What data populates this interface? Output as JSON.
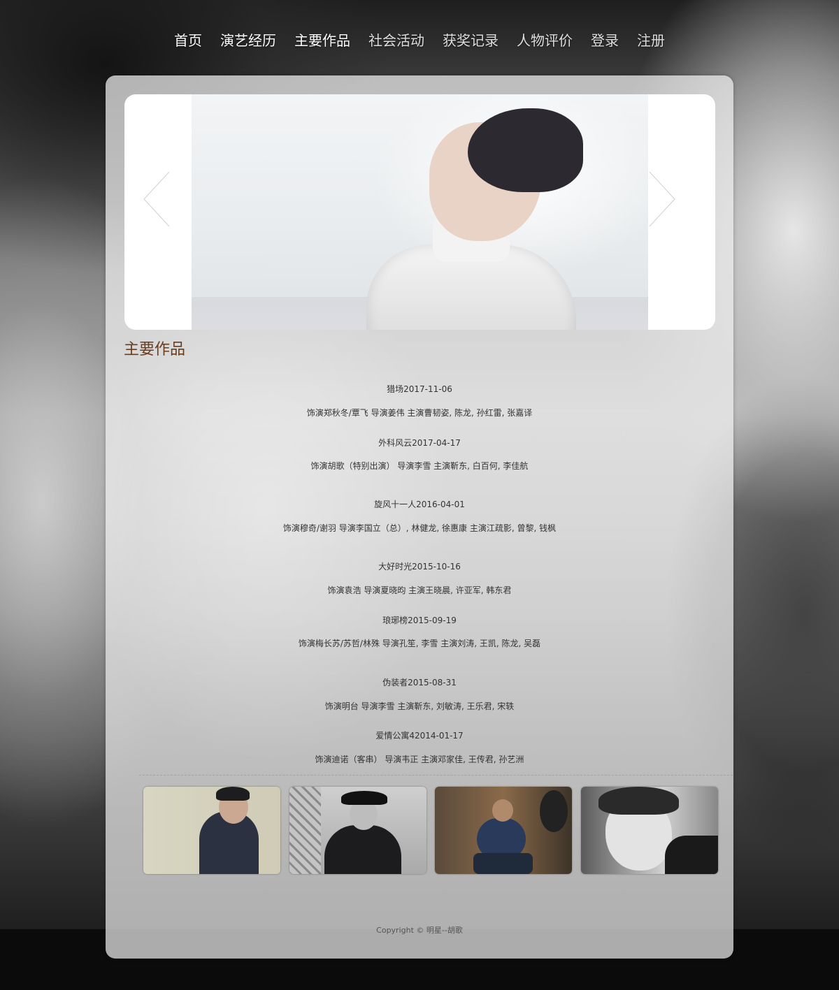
{
  "nav": {
    "items": [
      {
        "label": "首页"
      },
      {
        "label": "演艺经历"
      },
      {
        "label": "主要作品"
      },
      {
        "label": "社会活动"
      },
      {
        "label": "获奖记录"
      },
      {
        "label": "人物评价"
      },
      {
        "label": "登录"
      },
      {
        "label": "注册"
      }
    ]
  },
  "carousel": {
    "prev_icon": "chevron-left-icon",
    "next_icon": "chevron-right-icon"
  },
  "section": {
    "title": "主要作品"
  },
  "works": [
    {
      "title": "猎场2017-11-06",
      "desc": "饰演郑秋冬/覃飞 导演姜伟 主演曹韧姿, 陈龙, 孙红雷, 张嘉译"
    },
    {
      "title": "外科风云2017-04-17",
      "desc": "饰演胡歌（特别出演） 导演李雪 主演靳东, 白百何, 李佳航"
    },
    {
      "title": "旋风十一人2016-04-01",
      "desc": "饰演穆奇/谢羽 导演李国立（总）, 林健龙, 徐惠康 主演江疏影, 曾黎, 钱枫"
    },
    {
      "title": "大好时光2015-10-16",
      "desc": "饰演袁浩 导演夏晓昀 主演王晓晨, 许亚军, 韩东君"
    },
    {
      "title": "琅琊榜2015-09-19",
      "desc": "饰演梅长苏/苏哲/林殊 导演孔笙, 李雪 主演刘涛, 王凯, 陈龙, 吴磊"
    },
    {
      "title": "伪装者2015-08-31",
      "desc": "饰演明台 导演李雪 主演靳东, 刘敏涛, 王乐君, 宋轶"
    },
    {
      "title": "爱情公寓42014-01-17",
      "desc": "饰演迪诺（客串） 导演韦正 主演邓家佳, 王传君, 孙艺洲"
    }
  ],
  "thumbnails": [
    {
      "name": "photo-1"
    },
    {
      "name": "photo-2"
    },
    {
      "name": "photo-3"
    },
    {
      "name": "photo-4"
    }
  ],
  "footer": {
    "copyright": "Copyright © 明星--胡歌"
  },
  "colors": {
    "section_title": "#6b3d1c",
    "panel": "#ececec",
    "nav_text": "#ffffff"
  }
}
